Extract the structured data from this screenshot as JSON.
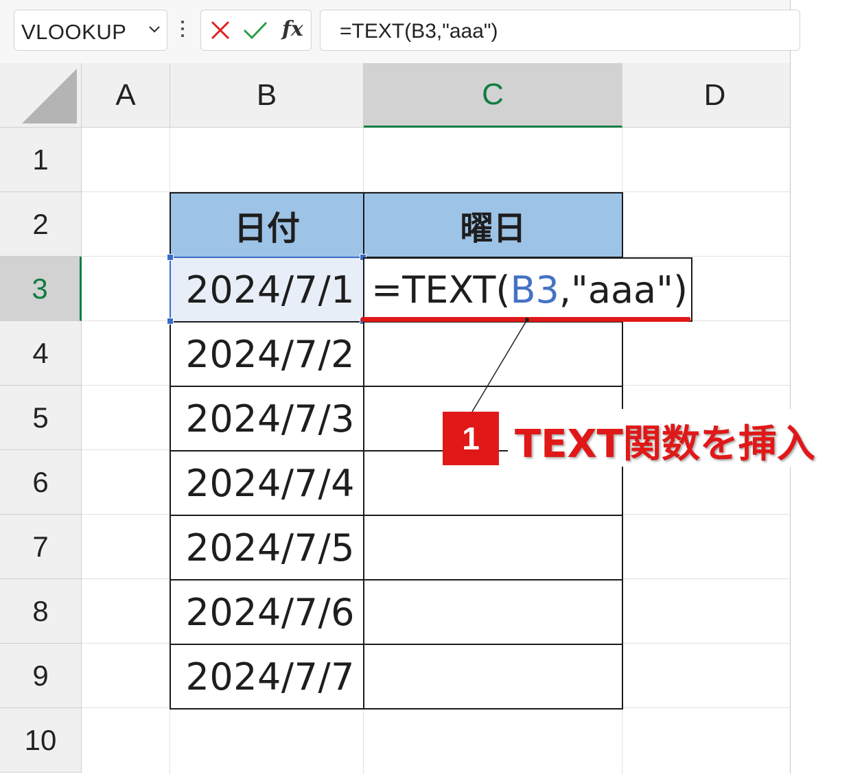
{
  "formula_bar": {
    "name_box": "VLOOKUP",
    "fx_label": "fx",
    "formula": "=TEXT(B3,\"aaa\")"
  },
  "columns": [
    "A",
    "B",
    "C",
    "D"
  ],
  "rows": [
    "1",
    "2",
    "3",
    "4",
    "5",
    "6",
    "7",
    "8",
    "9",
    "10"
  ],
  "table": {
    "headers": [
      "日付",
      "曜日"
    ],
    "dates": [
      "2024/7/1",
      "2024/7/2",
      "2024/7/3",
      "2024/7/4",
      "2024/7/5",
      "2024/7/6",
      "2024/7/7"
    ]
  },
  "edit_cell": {
    "prefix": "=TEXT(",
    "ref": "B3",
    "suffix": ",\"aaa\")"
  },
  "callout": {
    "step": "1",
    "text": "TEXT関数を挿入"
  },
  "colors": {
    "header_fill": "#9dc3e6",
    "selected_green": "#107c41",
    "accent_red": "#e01818",
    "ref_blue": "#4472c4"
  }
}
